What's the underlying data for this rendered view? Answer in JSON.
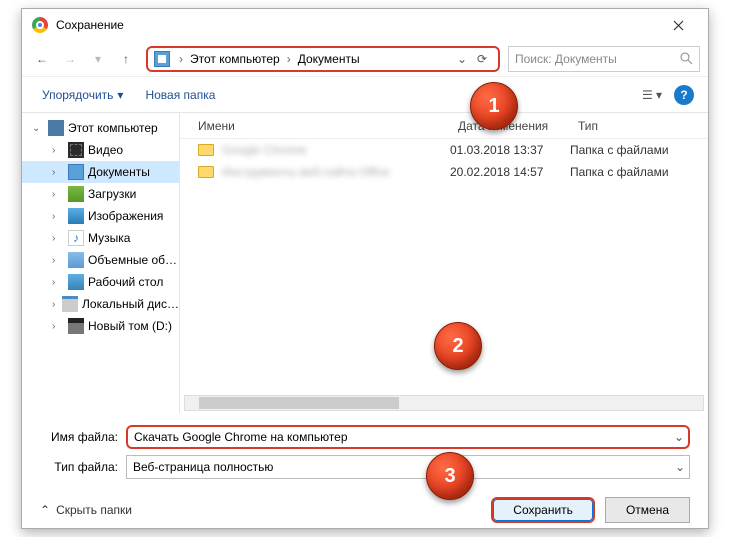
{
  "window": {
    "title": "Сохранение"
  },
  "breadcrumb": {
    "root": "Этот компьютер",
    "current": "Документы"
  },
  "search": {
    "placeholder": "Поиск: Документы"
  },
  "toolbar": {
    "organize": "Упорядочить",
    "newfolder": "Новая папка"
  },
  "tree": {
    "pc": "Этот компьютер",
    "video": "Видео",
    "docs": "Документы",
    "downloads": "Загрузки",
    "images": "Изображения",
    "music": "Музыка",
    "volumes": "Объемные об…",
    "desktop": "Рабочий стол",
    "localdisk": "Локальный дис…",
    "newvol": "Новый том (D:)"
  },
  "columns": {
    "name": "Имени",
    "date": "Дата изменения",
    "type": "Тип"
  },
  "rows": [
    {
      "name": "Google Chrome",
      "date": "01.03.2018 13:37",
      "type": "Папка с файлами"
    },
    {
      "name": "Инструменты веб-сайта Office",
      "date": "20.02.2018 14:57",
      "type": "Папка с файлами"
    }
  ],
  "fields": {
    "filename_label": "Имя файла:",
    "filename_value": "Скачать Google Chrome на компьютер",
    "filetype_label": "Тип файла:",
    "filetype_value": "Веб-страница полностью"
  },
  "footer": {
    "hide": "Скрыть папки",
    "save": "Сохранить",
    "cancel": "Отмена"
  },
  "badges": {
    "b1": "1",
    "b2": "2",
    "b3": "3"
  }
}
